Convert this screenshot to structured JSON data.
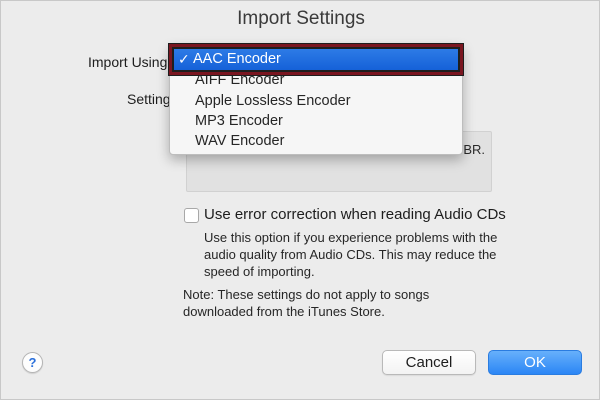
{
  "window": {
    "title": "Import Settings"
  },
  "form": {
    "import_using_label": "Import Using",
    "setting_label": "Setting",
    "details_text": "VBR."
  },
  "dropdown": {
    "selected": "AAC Encoder",
    "check_glyph": "✓",
    "options": [
      "AAC Encoder",
      "AIFF Encoder",
      "Apple Lossless Encoder",
      "MP3 Encoder",
      "WAV Encoder"
    ]
  },
  "error_correction": {
    "checked": false,
    "label": "Use error correction when reading Audio CDs",
    "help": "Use this option if you experience problems with the\naudio quality from Audio CDs.  This may reduce the\nspeed of importing."
  },
  "note": {
    "text": "Note: These settings do not apply to songs\ndownloaded from the iTunes Store."
  },
  "buttons": {
    "help": "?",
    "cancel": "Cancel",
    "ok": "OK"
  },
  "colors": {
    "accent": "#1d79f2",
    "selection": "#1561d8",
    "highlight_border": "#7a1620"
  }
}
